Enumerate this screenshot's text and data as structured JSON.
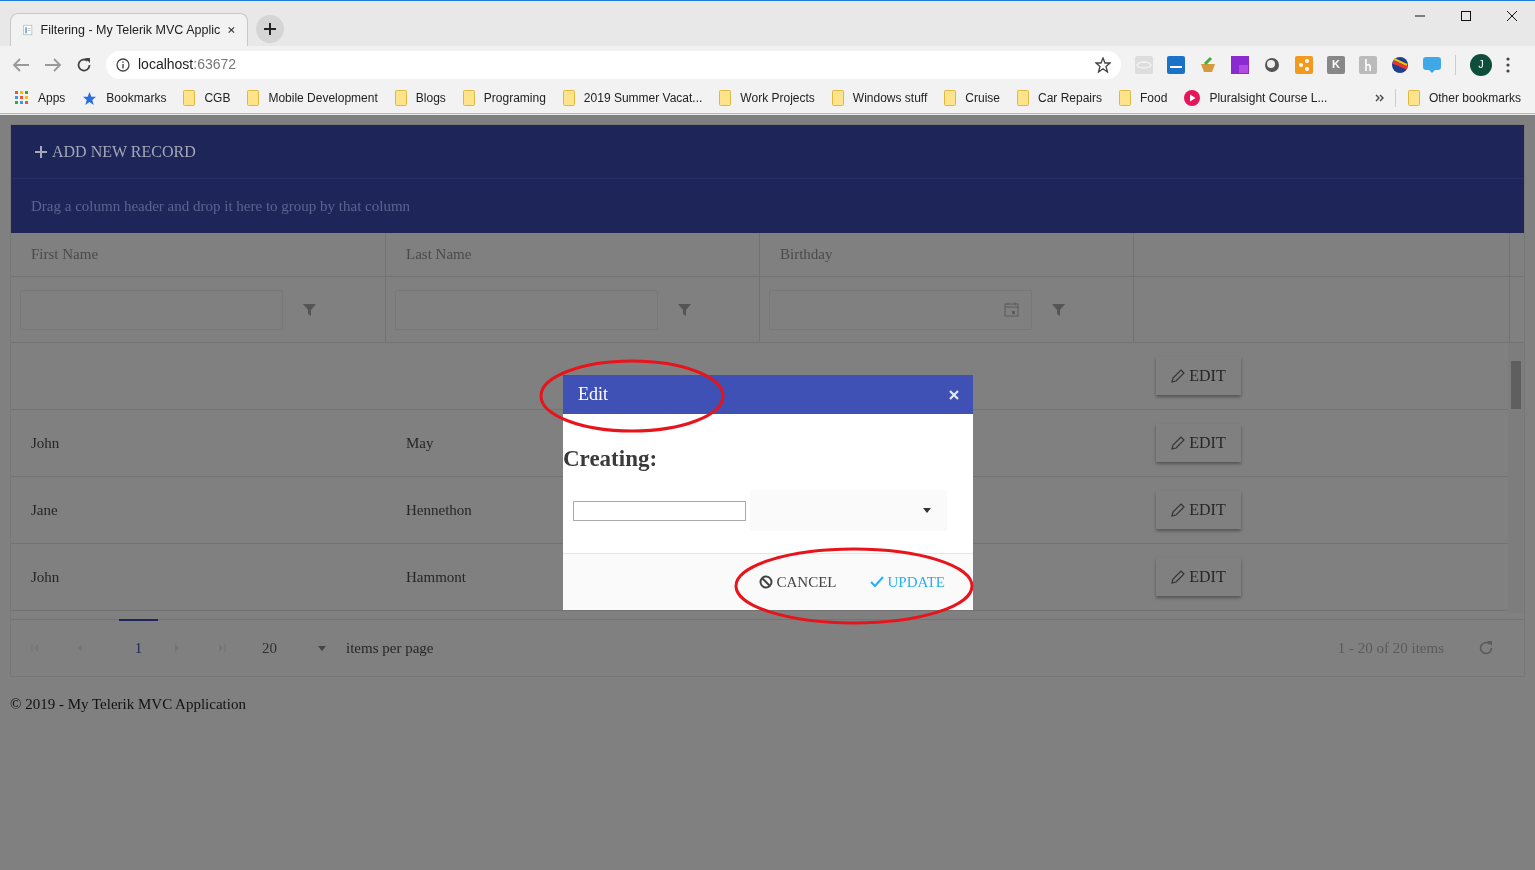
{
  "browser": {
    "tab_title": "Filtering - My Telerik MVC Applic",
    "address_host": "localhost",
    "address_port": ":63672",
    "extension_letter": "K",
    "profile_initial": "J",
    "bookmarks": [
      {
        "kind": "apps",
        "label": "Apps"
      },
      {
        "kind": "star",
        "label": "Bookmarks"
      },
      {
        "kind": "folder",
        "label": "CGB"
      },
      {
        "kind": "folder",
        "label": "Mobile Development"
      },
      {
        "kind": "folder",
        "label": "Blogs"
      },
      {
        "kind": "folder",
        "label": "Programing"
      },
      {
        "kind": "folder",
        "label": "2019 Summer Vacat..."
      },
      {
        "kind": "folder",
        "label": "Work Projects"
      },
      {
        "kind": "folder",
        "label": "Windows stuff"
      },
      {
        "kind": "folder",
        "label": "Cruise"
      },
      {
        "kind": "folder",
        "label": "Car Repairs"
      },
      {
        "kind": "folder",
        "label": "Food"
      },
      {
        "kind": "play",
        "label": "Pluralsight Course L..."
      }
    ],
    "other_bookmarks": "Other bookmarks"
  },
  "grid": {
    "add_button": "ADD NEW RECORD",
    "group_hint": "Drag a column header and drop it here to group by that column",
    "columns": [
      {
        "title": "First Name",
        "kind": "text"
      },
      {
        "title": "Last Name",
        "kind": "text"
      },
      {
        "title": "Birthday",
        "kind": "date"
      }
    ],
    "rows": [
      {
        "command": "EDIT"
      },
      {
        "first_name": "John",
        "last_name": "May",
        "command": "EDIT"
      },
      {
        "first_name": "Jane",
        "last_name": "Hennethon",
        "command": "EDIT"
      },
      {
        "first_name": "John",
        "last_name": "Hammont",
        "command": "EDIT"
      }
    ],
    "pager": {
      "page": "1",
      "page_size": "20",
      "page_size_label": "items per page",
      "info": "1 - 20 of 20 items"
    }
  },
  "dialog": {
    "title": "Edit",
    "heading": "Creating:",
    "buttons": [
      {
        "kind": "cancel",
        "label": "CANCEL"
      },
      {
        "kind": "update",
        "label": "UPDATE"
      }
    ]
  },
  "footer": "© 2019 - My Telerik MVC Application"
}
